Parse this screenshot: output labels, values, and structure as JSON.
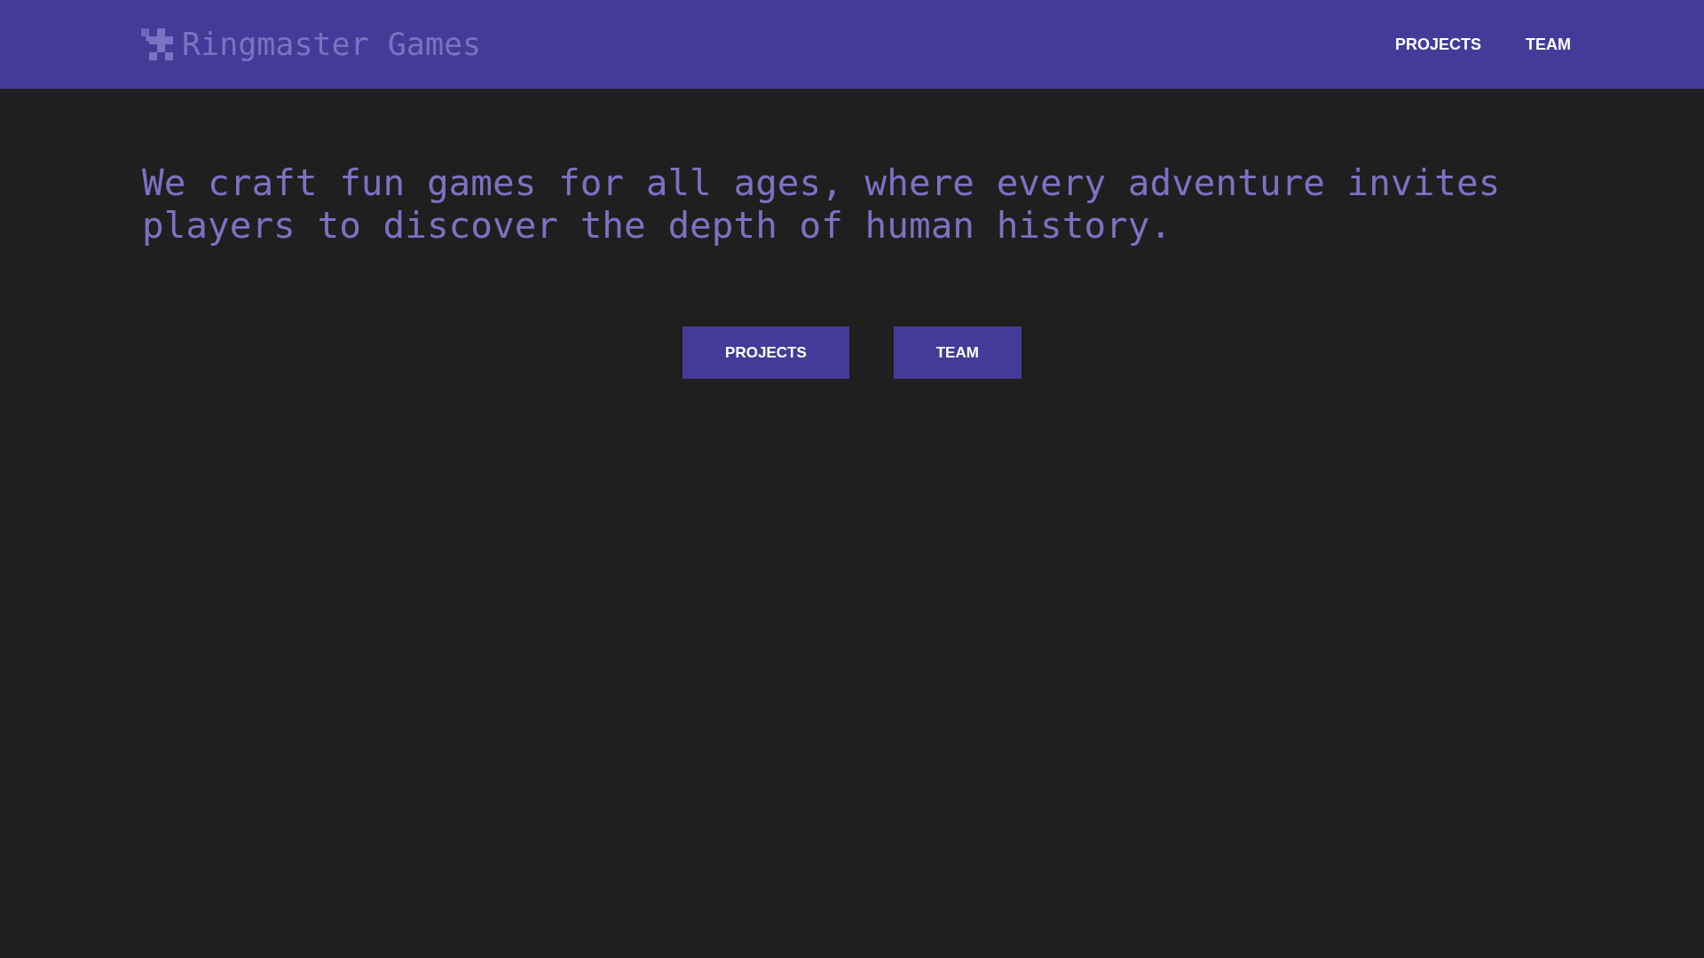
{
  "header": {
    "brand": "Ringmaster Games",
    "nav": [
      "PROJECTS",
      "TEAM"
    ]
  },
  "hero": {
    "headline": "We craft fun games for all ages, where every adventure invites players to discover the depth of human history.",
    "buttons": [
      "PROJECTS",
      "TEAM"
    ]
  }
}
